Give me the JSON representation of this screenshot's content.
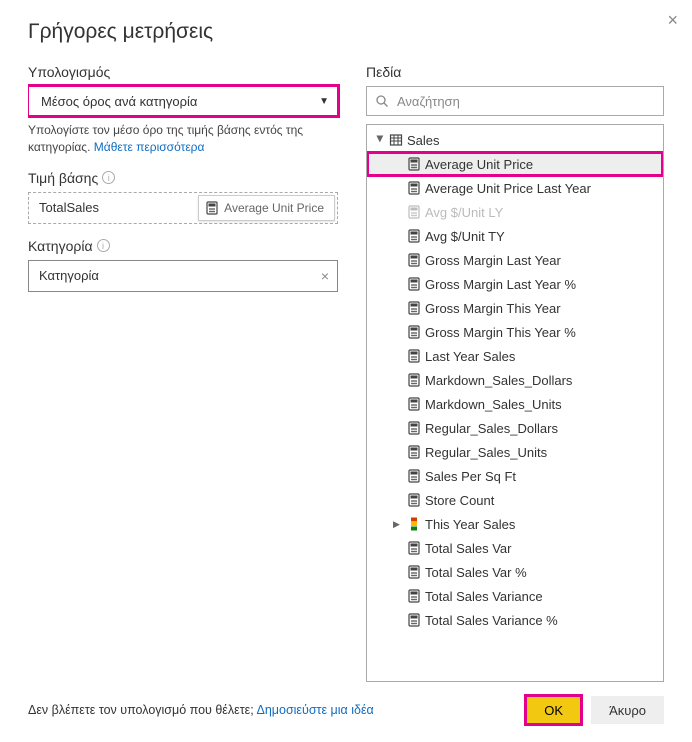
{
  "dialog": {
    "title": "Γρήγορες μετρήσεις",
    "close_tooltip": "Close"
  },
  "left": {
    "calculation_label": "Υπολογισμός",
    "calculation_value": "Μέσος όρος ανά κατηγορία",
    "helper_text_pre": "Υπολογίστε τον μέσο όρο της τιμής βάσης εντός της κατηγορίας.  ",
    "learn_more": "Μάθετε περισσότερα",
    "base_value_label": "Τιμή βάσης",
    "base_value_field": "TotalSales",
    "drag_ghost": "Average Unit Price",
    "category_label": "Κατηγορία",
    "category_value": "Κατηγορία"
  },
  "right": {
    "fields_label": "Πεδία",
    "search_placeholder": "Αναζήτηση",
    "table_name": "Sales",
    "fields": [
      {
        "label": "Average Unit Price",
        "icon": "calc",
        "selected": true,
        "highlight": true
      },
      {
        "label": "Average Unit Price Last Year",
        "icon": "calc"
      },
      {
        "label": "Avg $/Unit LY",
        "icon": "calc",
        "disabled": true
      },
      {
        "label": "Avg $/Unit TY",
        "icon": "calc"
      },
      {
        "label": "Gross Margin Last Year",
        "icon": "calc"
      },
      {
        "label": "Gross Margin Last Year %",
        "icon": "calc"
      },
      {
        "label": "Gross Margin This Year",
        "icon": "calc"
      },
      {
        "label": "Gross Margin This Year %",
        "icon": "calc"
      },
      {
        "label": "Last Year Sales",
        "icon": "calc"
      },
      {
        "label": "Markdown_Sales_Dollars",
        "icon": "calc"
      },
      {
        "label": "Markdown_Sales_Units",
        "icon": "calc"
      },
      {
        "label": "Regular_Sales_Dollars",
        "icon": "calc"
      },
      {
        "label": "Regular_Sales_Units",
        "icon": "calc"
      },
      {
        "label": "Sales Per Sq Ft",
        "icon": "calc"
      },
      {
        "label": "Store Count",
        "icon": "calc"
      },
      {
        "label": "This Year Sales",
        "icon": "kpi",
        "expandable": true
      },
      {
        "label": "Total Sales Var",
        "icon": "calc"
      },
      {
        "label": "Total Sales Var %",
        "icon": "calc"
      },
      {
        "label": "Total Sales Variance",
        "icon": "calc"
      },
      {
        "label": "Total Sales Variance %",
        "icon": "calc"
      }
    ]
  },
  "footer": {
    "prompt_pre": "Δεν βλέπετε τον υπολογισμό που θέλετε; ",
    "prompt_link": "Δημοσιεύστε μια ιδέα",
    "ok": "OK",
    "cancel": "Άκυρο"
  }
}
